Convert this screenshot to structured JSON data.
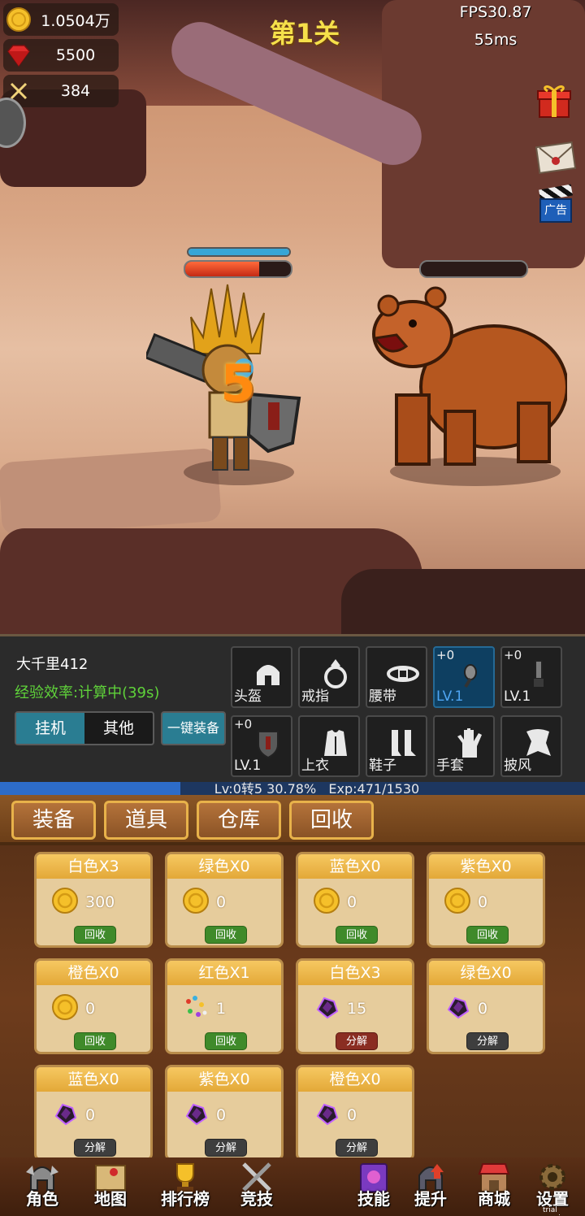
{
  "hud": {
    "gold": "1.0504万",
    "gems": "5500",
    "power": "384",
    "level_title": "第1关",
    "fps": "FPS30.87",
    "ping": "55ms",
    "ad_label": "广告"
  },
  "battle": {
    "damage_number": "5",
    "hero_hp_fraction": 0.7,
    "hero_mp_fraction": 1.0,
    "enemy_hp_fraction": 0.0
  },
  "character": {
    "name": "大千里412",
    "exp_rate_label": "经验效率:",
    "exp_rate_value": "计算中(39s)",
    "mode_tabs": [
      "挂机",
      "其他"
    ],
    "auto_equip": "一键装备",
    "slots": [
      {
        "label": "头盔",
        "plus": "",
        "icon": "helmet-icon",
        "highlight": false
      },
      {
        "label": "戒指",
        "plus": "",
        "icon": "ring-icon",
        "highlight": false
      },
      {
        "label": "腰带",
        "plus": "",
        "icon": "belt-icon",
        "highlight": false
      },
      {
        "label": "LV.1",
        "plus": "+0",
        "icon": "weapon-icon",
        "highlight": true
      },
      {
        "label": "LV.1",
        "plus": "+0",
        "icon": "dagger-icon",
        "highlight": false
      },
      {
        "label": "LV.1",
        "plus": "+0",
        "icon": "shield-icon",
        "highlight": false
      },
      {
        "label": "上衣",
        "plus": "",
        "icon": "armor-icon",
        "highlight": false
      },
      {
        "label": "鞋子",
        "plus": "",
        "icon": "boots-icon",
        "highlight": false
      },
      {
        "label": "手套",
        "plus": "",
        "icon": "glove-icon",
        "highlight": false
      },
      {
        "label": "披风",
        "plus": "",
        "icon": "cape-icon",
        "highlight": false
      }
    ]
  },
  "exp": {
    "text": "Lv:0转5 30.78%",
    "exp_text": "Exp:471/1530",
    "fraction": 0.3078
  },
  "tabs": [
    "装备",
    "道具",
    "仓库",
    "回收"
  ],
  "recycle": [
    {
      "title": "白色X3",
      "value": "300",
      "icon": "gold-coin-icon",
      "button": "回收",
      "btn_color": "green"
    },
    {
      "title": "绿色X0",
      "value": "0",
      "icon": "gold-coin-icon",
      "button": "回收",
      "btn_color": "green"
    },
    {
      "title": "蓝色X0",
      "value": "0",
      "icon": "gold-coin-icon",
      "button": "回收",
      "btn_color": "green"
    },
    {
      "title": "紫色X0",
      "value": "0",
      "icon": "gold-coin-icon",
      "button": "回收",
      "btn_color": "green"
    },
    {
      "title": "橙色X0",
      "value": "0",
      "icon": "gold-coin-icon",
      "button": "回收",
      "btn_color": "green"
    },
    {
      "title": "红色X1",
      "value": "1",
      "icon": "gem-shards-icon",
      "button": "回收",
      "btn_color": "green"
    },
    {
      "title": "白色X3",
      "value": "15",
      "icon": "dark-crystal-icon",
      "button": "分解",
      "btn_color": "red"
    },
    {
      "title": "绿色X0",
      "value": "0",
      "icon": "dark-crystal-icon",
      "button": "分解",
      "btn_color": "gray"
    },
    {
      "title": "蓝色X0",
      "value": "0",
      "icon": "dark-crystal-icon",
      "button": "分解",
      "btn_color": "gray"
    },
    {
      "title": "紫色X0",
      "value": "0",
      "icon": "dark-crystal-icon",
      "button": "分解",
      "btn_color": "gray"
    },
    {
      "title": "橙色X0",
      "value": "0",
      "icon": "dark-crystal-icon",
      "button": "分解",
      "btn_color": "gray"
    }
  ],
  "nav": [
    {
      "label": "角色",
      "icon": "knight-helmet-icon"
    },
    {
      "label": "地图",
      "icon": "map-icon"
    },
    {
      "label": "排行榜",
      "icon": "trophy-icon"
    },
    {
      "label": "竞技",
      "icon": "crossed-swords-icon"
    },
    {
      "label": "技能",
      "icon": "spellbook-icon"
    },
    {
      "label": "提升",
      "icon": "upgrade-helmet-icon"
    },
    {
      "label": "商城",
      "icon": "shop-icon"
    },
    {
      "label": "设置",
      "icon": "gear-icon"
    }
  ],
  "watermark": "trial version",
  "colors": {
    "gold": "#f5c02a",
    "exp_fill": "#2d6cc8",
    "slot_highlight": "#0e3f61",
    "exp_rate_green": "#5fd23a"
  }
}
